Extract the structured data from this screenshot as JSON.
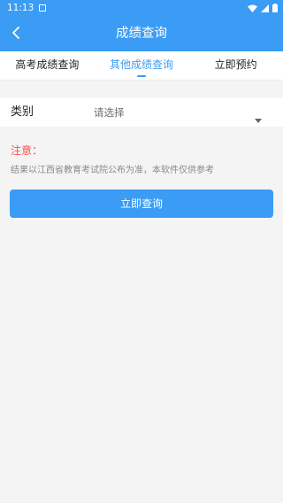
{
  "status_bar": {
    "time": "11:13"
  },
  "app_bar": {
    "title": "成绩查询"
  },
  "tabs": [
    {
      "label": "高考成绩查询",
      "active": false
    },
    {
      "label": "其他成绩查询",
      "active": true
    },
    {
      "label": "立即预约",
      "active": false
    }
  ],
  "form": {
    "category_label": "类别",
    "category_placeholder": "请选择"
  },
  "notice": {
    "title": "注意：",
    "text": "结果以江西省教育考试院公布为准，本软件仅供参考"
  },
  "query_button": {
    "label": "立即查询"
  },
  "colors": {
    "primary": "#3a9cf5",
    "notice": "#ff4d4d",
    "background": "#f4f4f4"
  }
}
